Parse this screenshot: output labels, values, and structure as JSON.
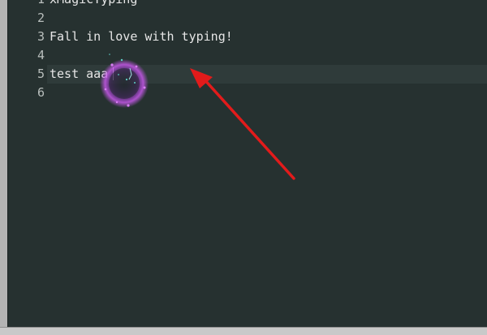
{
  "editor": {
    "lines": [
      {
        "number": "1",
        "text": "xMagicTyping"
      },
      {
        "number": "2",
        "text": ""
      },
      {
        "number": "3",
        "text": "Fall in love with typing!"
      },
      {
        "number": "4",
        "text": ""
      },
      {
        "number": "5",
        "text": "test aaa"
      },
      {
        "number": "6",
        "text": ""
      }
    ],
    "current_line": "5"
  },
  "overlay": {
    "annotation": "red-arrow-pointing-to-cursor",
    "effect": "sparkle-burst"
  },
  "colors": {
    "editor_bg": "#263130",
    "current_line_bg": "#2f3b3a",
    "text": "#e6e6e6",
    "arrow": "#e21b1b",
    "burst": "#b04bd6"
  }
}
